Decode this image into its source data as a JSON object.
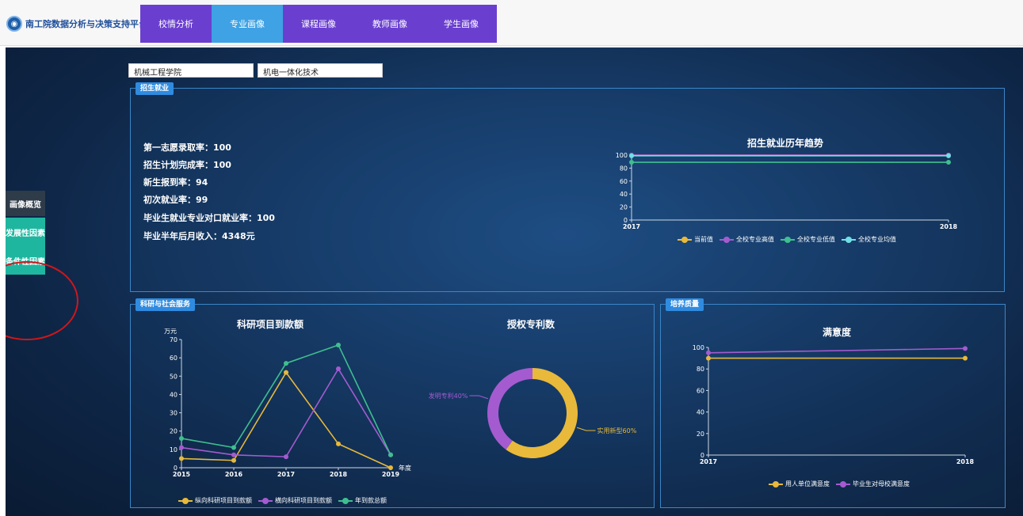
{
  "header": {
    "logo_symbol": "◉",
    "platform_title": "南工院数据分析与决策支持平台",
    "nav": [
      {
        "label": "校情分析",
        "active": false
      },
      {
        "label": "专业画像",
        "active": true
      },
      {
        "label": "课程画像",
        "active": false
      },
      {
        "label": "教师画像",
        "active": false
      },
      {
        "label": "学生画像",
        "active": false
      }
    ]
  },
  "sidebar": {
    "items": [
      {
        "label": "画像概览"
      },
      {
        "label": "发展性因素"
      },
      {
        "label": "条件性因素"
      }
    ]
  },
  "filters": {
    "college": "机械工程学院",
    "major": "机电一体化技术"
  },
  "colors": {
    "nav_bg": "#6a3fd0",
    "nav_active": "#3ea2e4",
    "side_green": "#1fb6a0",
    "annotation_red": "#d0161b",
    "yellow": "#e8b93a",
    "purple": "#a45bd0",
    "green": "#3fbf8f",
    "cyan": "#6fe0e6"
  },
  "enrollment": {
    "tag": "招生就业",
    "stats": [
      {
        "label": "第一志愿录取率：",
        "value": "100"
      },
      {
        "label": "招生计划完成率：",
        "value": "100"
      },
      {
        "label": "新生报到率：",
        "value": "94"
      },
      {
        "label": "初次就业率：",
        "value": "99"
      },
      {
        "label": "毕业生就业专业对口就业率：",
        "value": "100"
      },
      {
        "label": "毕业半年后月收入：",
        "value": "4348元"
      }
    ]
  },
  "research": {
    "tag": "科研与社会服务"
  },
  "quality": {
    "tag": "培养质量"
  },
  "chart_data": [
    {
      "type": "line",
      "title": "招生就业历年趋势",
      "x": [
        2017,
        2018
      ],
      "ylim": [
        0,
        100
      ],
      "yticks": [
        0,
        20,
        40,
        60,
        80,
        100
      ],
      "legend_position": "bottom",
      "series": [
        {
          "name": "当前值",
          "color": "#e8b93a",
          "values": [
            100,
            100
          ]
        },
        {
          "name": "全校专业高值",
          "color": "#a45bd0",
          "values": [
            100,
            100
          ]
        },
        {
          "name": "全校专业低值",
          "color": "#3fbf8f",
          "values": [
            89,
            89
          ]
        },
        {
          "name": "全校专业均值",
          "color": "#6fe0e6",
          "values": [
            99,
            99
          ]
        }
      ]
    },
    {
      "type": "line",
      "title": "科研项目到款额",
      "ylabel": "万元",
      "xlabel": "年度",
      "x": [
        2015,
        2016,
        2017,
        2018,
        2019
      ],
      "ylim": [
        0,
        70
      ],
      "yticks": [
        0,
        10,
        20,
        30,
        40,
        50,
        60,
        70
      ],
      "legend_position": "bottom",
      "series": [
        {
          "name": "纵向科研项目到款额",
          "color": "#e8b93a",
          "values": [
            5,
            4,
            52,
            13,
            0
          ]
        },
        {
          "name": "横向科研项目到款额",
          "color": "#a45bd0",
          "values": [
            11,
            7,
            6,
            54,
            7
          ]
        },
        {
          "name": "年到款总额",
          "color": "#3fbf8f",
          "values": [
            16,
            11,
            57,
            67,
            7
          ]
        }
      ]
    },
    {
      "type": "pie",
      "title": "授权专利数",
      "slices": [
        {
          "label": "实用新型60%",
          "value": 60,
          "color": "#e8b93a"
        },
        {
          "label": "发明专利40%",
          "value": 40,
          "color": "#a45bd0"
        }
      ]
    },
    {
      "type": "line",
      "title": "满意度",
      "x": [
        2017,
        2018
      ],
      "ylim": [
        0,
        100
      ],
      "yticks": [
        0,
        20,
        40,
        60,
        80,
        100
      ],
      "legend_position": "bottom",
      "series": [
        {
          "name": "用人单位满意度",
          "color": "#e8b93a",
          "values": [
            90,
            90
          ]
        },
        {
          "name": "毕业生对母校满意度",
          "color": "#a45bd0",
          "values": [
            95,
            99
          ]
        }
      ]
    }
  ]
}
